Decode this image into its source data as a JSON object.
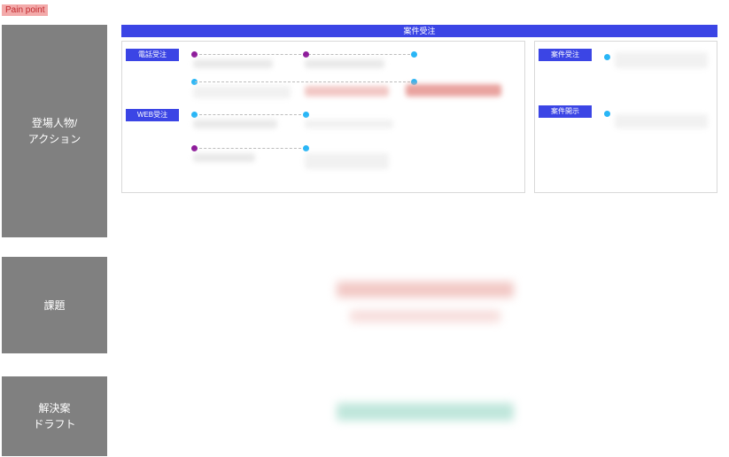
{
  "tag": {
    "painpoint": "Pain point"
  },
  "sidebar": {
    "actors": "登場人物/\nアクション",
    "issues": "課題",
    "draft": "解決案\nドラフト"
  },
  "header": {
    "title": "案件受注"
  },
  "panel_left": {
    "rows": [
      {
        "label": "電話受注"
      },
      {
        "label": "WEB受注"
      }
    ]
  },
  "panel_right": {
    "rows": [
      {
        "label": "案件受注"
      },
      {
        "label": "案件開示"
      }
    ]
  }
}
